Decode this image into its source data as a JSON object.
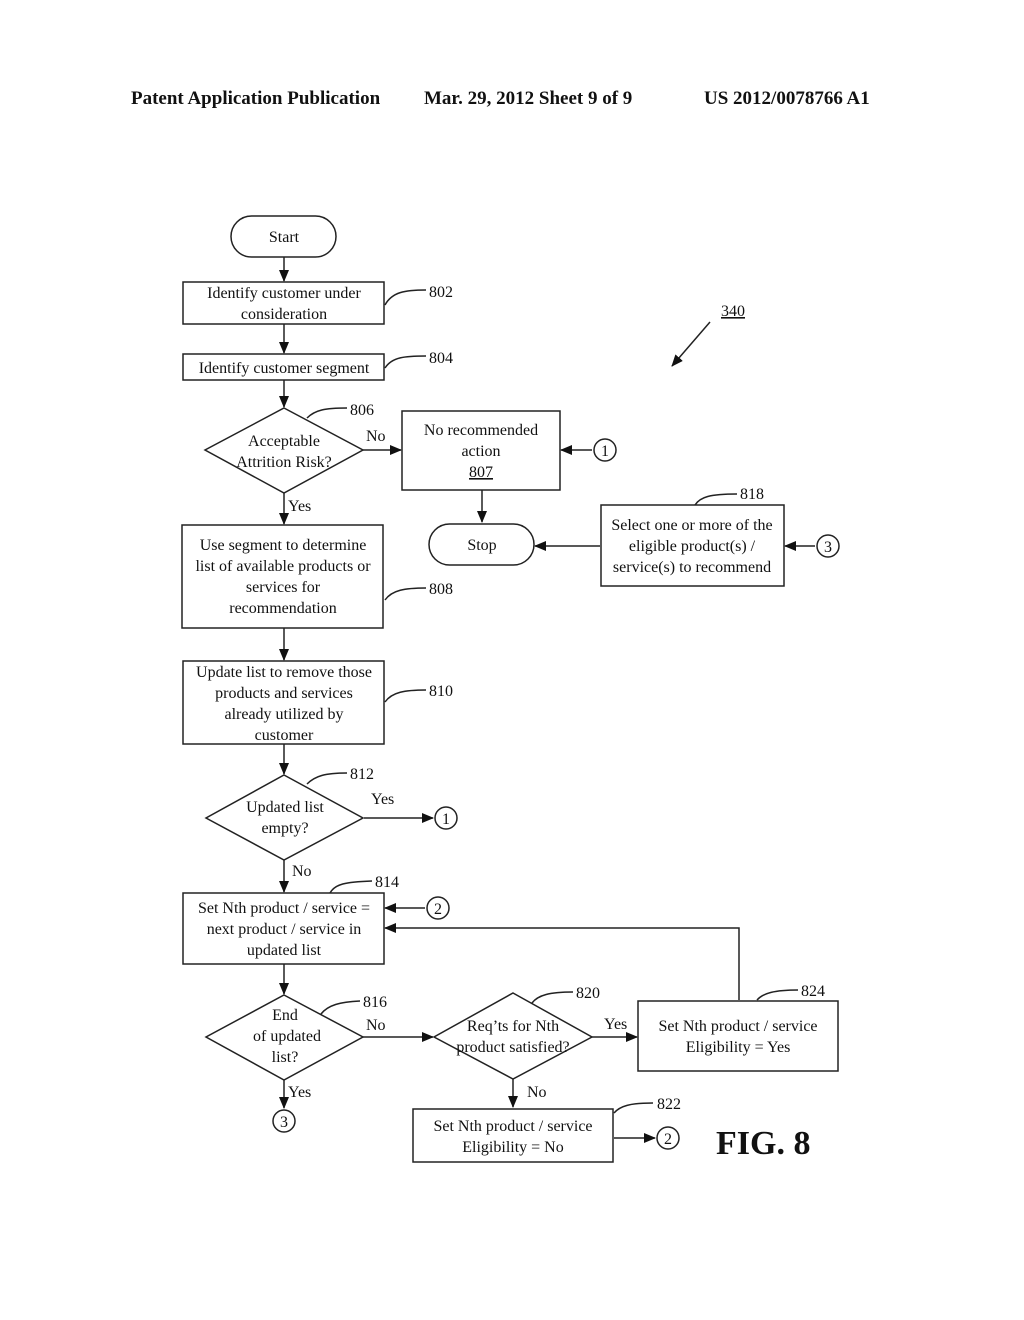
{
  "header": {
    "publication": "Patent Application Publication",
    "date_sheet": "Mar. 29, 2012  Sheet 9 of 9",
    "patent_number": "US 2012/0078766 A1"
  },
  "figure": {
    "label": "FIG. 8",
    "reference": "340"
  },
  "nodes": {
    "start": {
      "text": [
        "Start"
      ]
    },
    "n802": {
      "ref": "802",
      "text": [
        "Identify customer under",
        "consideration"
      ]
    },
    "n804": {
      "ref": "804",
      "text": [
        "Identify customer segment"
      ]
    },
    "n806": {
      "ref": "806",
      "text": [
        "Acceptable",
        "Attrition Risk?"
      ]
    },
    "n807": {
      "ref": "807",
      "text": [
        "No recommended",
        "action"
      ]
    },
    "stop": {
      "text": [
        "Stop"
      ]
    },
    "n808": {
      "ref": "808",
      "text": [
        "Use segment to determine",
        "list of available products or",
        "services for",
        "recommendation"
      ]
    },
    "n810": {
      "ref": "810",
      "text": [
        "Update list to remove those",
        "products and services",
        "already utilized by",
        "customer"
      ]
    },
    "n812": {
      "ref": "812",
      "text": [
        "Updated list",
        "empty?"
      ]
    },
    "n814": {
      "ref": "814",
      "text": [
        "Set Nth product / service =",
        "next product / service in",
        "updated list"
      ]
    },
    "n816": {
      "ref": "816",
      "text": [
        "End",
        "of updated",
        "list?"
      ]
    },
    "n818": {
      "ref": "818",
      "text": [
        "Select one or more of the",
        "eligible product(s) /",
        "service(s) to recommend"
      ]
    },
    "n820": {
      "ref": "820",
      "text": [
        "Req’ts for Nth",
        "product satisfied?"
      ]
    },
    "n822": {
      "ref": "822",
      "text": [
        "Set Nth product / service",
        "Eligibility = No"
      ]
    },
    "n824": {
      "ref": "824",
      "text": [
        "Set Nth product / service",
        "Eligibility = Yes"
      ]
    }
  },
  "connectors": {
    "c1_a": "1",
    "c1_b": "1",
    "c2_a": "2",
    "c2_b": "2",
    "c3_a": "3",
    "c3_b": "3"
  },
  "edge_labels": {
    "e806_no": "No",
    "e806_yes": "Yes",
    "e812_yes": "Yes",
    "e812_no": "No",
    "e816_no": "No",
    "e816_yes": "Yes",
    "e820_yes": "Yes",
    "e820_no": "No"
  }
}
